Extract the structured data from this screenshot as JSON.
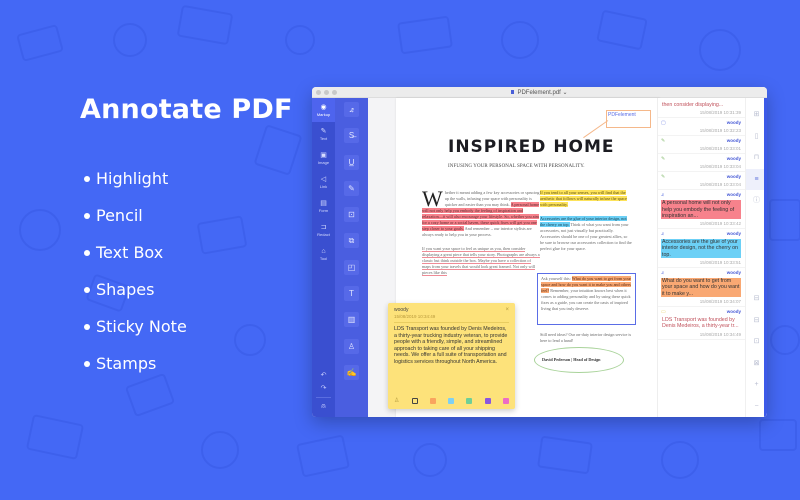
{
  "promo": {
    "title": "Annotate PDF",
    "features": [
      "Highlight",
      "Pencil",
      "Text Box",
      "Shapes",
      "Sticky Note",
      "Stamps"
    ]
  },
  "window": {
    "title": "PDFelement.pdf",
    "title_chevron": "⌄"
  },
  "nav_rail": {
    "items": [
      {
        "label": "Markup",
        "icon": "◉",
        "active": true
      },
      {
        "label": "Text",
        "icon": "✎"
      },
      {
        "label": "Image",
        "icon": "▣"
      },
      {
        "label": "Link",
        "icon": "◁"
      },
      {
        "label": "Form",
        "icon": "▤"
      },
      {
        "label": "Redact",
        "icon": "⊐"
      },
      {
        "label": "Tool",
        "icon": "⌂"
      }
    ],
    "undo_icon": "↶",
    "redo_icon": "↷",
    "account_icon": "⍝"
  },
  "tools": [
    {
      "name": "highlight-tool",
      "icon": "⦨"
    },
    {
      "name": "strikethrough-tool",
      "icon": "S̶"
    },
    {
      "name": "underline-tool",
      "icon": "U̲"
    },
    {
      "name": "pencil-tool",
      "icon": "✎"
    },
    {
      "name": "textbox-tool",
      "icon": "⊡"
    },
    {
      "name": "note-tool",
      "icon": "⧉"
    },
    {
      "name": "shape-tool",
      "icon": "◰"
    },
    {
      "name": "text-tool",
      "icon": "T"
    },
    {
      "name": "area-tool",
      "icon": "▥"
    },
    {
      "name": "stamp-tool",
      "icon": "♙"
    },
    {
      "name": "signature-tool",
      "icon": "✍"
    }
  ],
  "document": {
    "callout_text": "PDFelement",
    "title": "INSPIRED HOME",
    "subtitle": "INFUSING YOUR PERSONAL SPACE WITH PERSONALITY.",
    "col1_p1_dropcap": "W",
    "col1_p1_plain": "hether it meant adding a few key accessories or sprucing up the walls, infusing your space with personality is quicker and easier than you may think. ",
    "col1_p1_highlight": "A personal home will not only help you embody the feeling of inspiration and relaxation—it will also encourage your lifestyle. So, whether you aim for a cozy home or a social haven, these quick fixes will get you one step closer to your goals.",
    "col1_p1_end": " And remember – our interior stylists are always ready to help you in your process.",
    "col1_p2_underline": "If you want your space to feel as unique as you, then consider displaying a great piece that tells your story. Photographs are always a classic but think outside the box. Maybe you have a collection of maps from your travels that would look great framed. Not only will pieces like this",
    "col2_p1_highlight": "If you tend to all your senses, you will find that the aesthetic that follows will naturally infuse the space with personality.",
    "col2_p2_highlight": "Accessories are the glue of your interior design, not the cherry on top.",
    "col2_p2_plain": " Think of what you want from your accessories, not just visually but practically. Accessories should be one of your greatest allies, so be sure to browse our accessories collection to find the perfect glue for your space.",
    "col2_p3_lead": "Ask yourself this: ",
    "col2_p3_highlight": "What do you want to get from your space and how do you want it to make you and others feel?",
    "col2_p3_plain": " Remember, your intuition knows best when it comes to adding personality and by using these quick fixes as a guide, you can create the oasis of inspired living that you truly deserve.",
    "col2_p4": "Still need ideas? Our on-duty interior design service is here to lend a hand!",
    "signature": "David Pederson | Head of Design"
  },
  "sticky_note": {
    "author": "woody",
    "timestamp": "15/08/2019 10:34:49",
    "close_icon": "×",
    "content": "LDS Transport was founded by Denis Medeiros, a thirty-year trucking industry veteran, to provide people with a friendly, simple, and streamlined approach to taking care of all your shipping needs. We offer a full suite of transportation and logistics services throughout North America.",
    "stamp_icon": "♙",
    "colors": [
      "outline",
      "#f9a45e",
      "#7fd0f2",
      "#6fcf97",
      "#8a56e0",
      "#ec6cc6"
    ]
  },
  "comments": [
    {
      "type": "underline",
      "icon": "",
      "user": "",
      "excerpt": "then consider displaying...",
      "timestamp": "15/08/2019 10:31:39"
    },
    {
      "type": "textbox",
      "icon": "▢",
      "user": "woody",
      "excerpt": "",
      "timestamp": "15/08/2019 10:32:23"
    },
    {
      "type": "pencil",
      "icon": "✎",
      "user": "woody",
      "excerpt": "",
      "timestamp": "15/08/2019 10:33:01"
    },
    {
      "type": "pencil",
      "icon": "✎",
      "user": "woody",
      "excerpt": "",
      "timestamp": "15/08/2019 10:33:04"
    },
    {
      "type": "pencil",
      "icon": "✎",
      "user": "woody",
      "excerpt": "",
      "timestamp": "15/08/2019 10:33:04"
    },
    {
      "type": "highlight",
      "icon": "⦨",
      "user": "woody",
      "excerpt": "A personal home will not only help you embody the feeling of inspiration an...",
      "timestamp": "15/08/2019 10:33:42",
      "color": "#f7828c"
    },
    {
      "type": "highlight",
      "icon": "⦨",
      "user": "woody",
      "excerpt": "Accessories are the glue of your interior design, not the cherry on top.",
      "timestamp": "15/08/2019 10:33:51",
      "color": "#6cd0f6"
    },
    {
      "type": "highlight",
      "icon": "⦨",
      "user": "woody",
      "excerpt": "What do you want to get from your space and how do you want it to make y...",
      "timestamp": "15/08/2019 10:34:07",
      "color": "#f9a873"
    },
    {
      "type": "note",
      "icon": "▭",
      "user": "woody",
      "excerpt": "LDS Transport was founded by Denis Medeiros, a thirty-year tr...",
      "timestamp": "15/08/2019 10:34:49"
    }
  ],
  "right_rail": {
    "icons": [
      "⊞",
      "▯",
      "⊓",
      "≡",
      "ⓘ",
      "",
      "",
      "",
      "",
      "⊟",
      "⊟",
      "⊡",
      "⊠",
      "+",
      "−"
    ]
  }
}
